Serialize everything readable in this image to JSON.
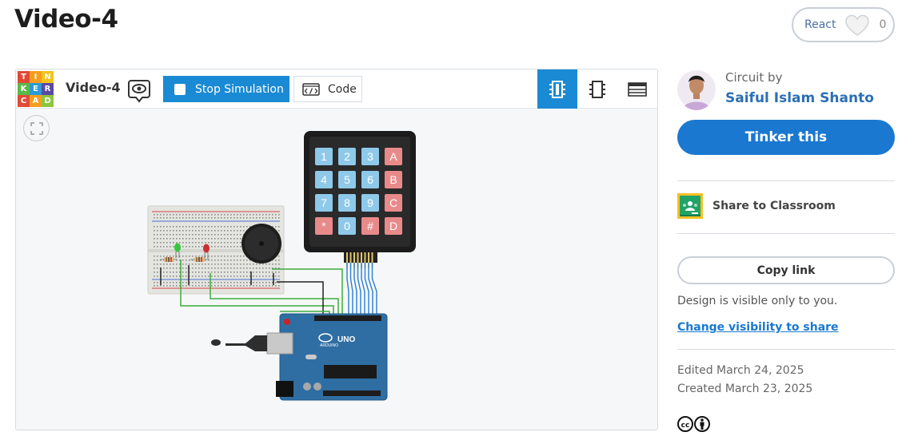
{
  "page": {
    "title": "Video-4"
  },
  "react": {
    "label": "React",
    "count": "0"
  },
  "viewer": {
    "design_name": "Video-4",
    "stop_label": "Stop Simulation",
    "code_label": "Code",
    "logo_letters": [
      "T",
      "I",
      "N",
      "K",
      "E",
      "R",
      "C",
      "A",
      "D"
    ],
    "logo_colors": [
      "#e04a37",
      "#f59e1d",
      "#f3c31c",
      "#5ab948",
      "#2b9bd7",
      "#5a4aa3",
      "#e04a37",
      "#f59e1d",
      "#8dc63f"
    ]
  },
  "keypad": {
    "keys": [
      "1",
      "2",
      "3",
      "A",
      "4",
      "5",
      "6",
      "B",
      "7",
      "8",
      "9",
      "C",
      "*",
      "0",
      "#",
      "D"
    ]
  },
  "board": {
    "brand": "UNO",
    "maker": "ARDUINO"
  },
  "sidebar": {
    "circuit_by": "Circuit by",
    "author": "Saiful Islam Shanto",
    "tinker_label": "Tinker this",
    "classroom_label": "Share to Classroom",
    "copy_label": "Copy link",
    "visibility_note": "Design is visible only to you.",
    "change_visibility": "Change visibility to share",
    "edited": "Edited March 24, 2025",
    "created": "Created March 23, 2025"
  },
  "colors": {
    "accent": "#1a8ad4",
    "tinker_button": "#1a78d0",
    "author_link": "#2a6fb5",
    "key_blue": "#8ec9ea",
    "key_red": "#e88a8a"
  }
}
